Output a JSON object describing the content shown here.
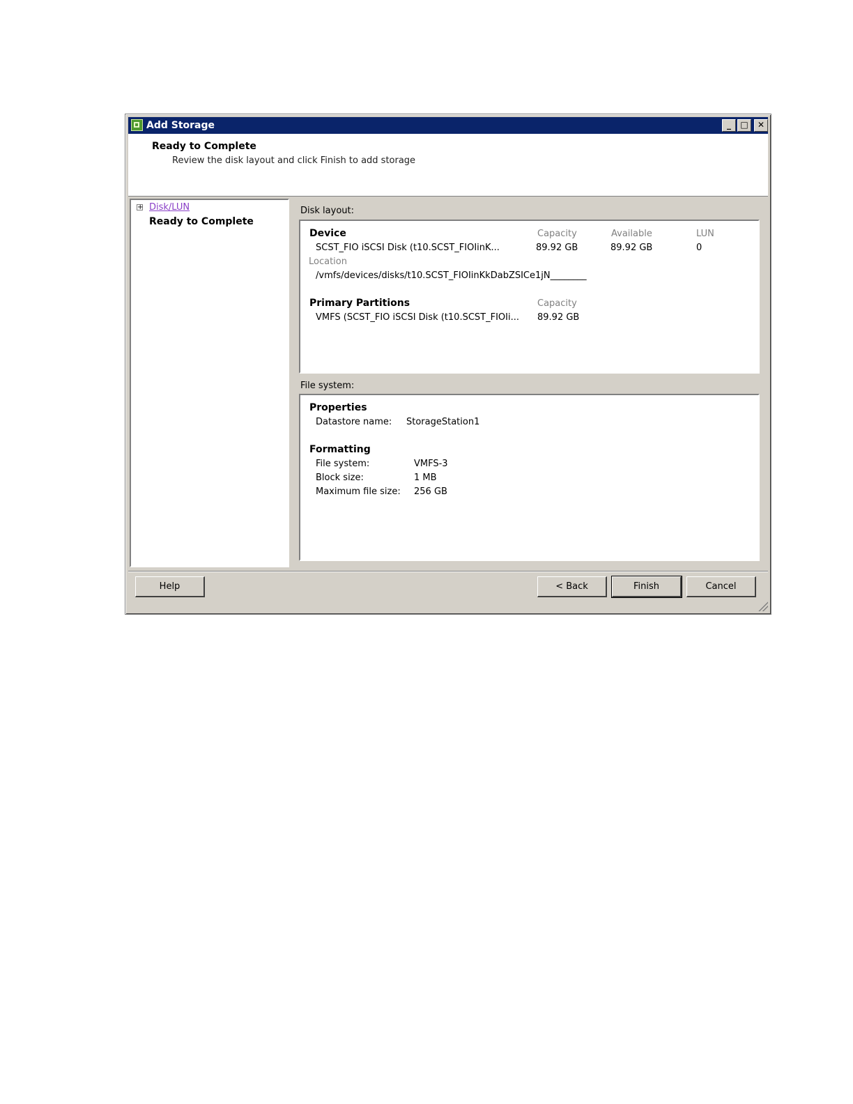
{
  "window": {
    "title": "Add Storage",
    "controls": {
      "minimize": "_",
      "maximize": "□",
      "close": "✕"
    }
  },
  "header": {
    "title": "Ready to Complete",
    "subtitle": "Review the disk layout and click Finish to add storage"
  },
  "nav": {
    "expand_symbol": "+",
    "link": "Disk/LUN",
    "current": "Ready to Complete"
  },
  "disk_layout": {
    "label": "Disk layout:",
    "device_header": "Device",
    "col_capacity": "Capacity",
    "col_available": "Available",
    "col_lun": "LUN",
    "device_name": "SCST_FIO iSCSI Disk (t10.SCST_FIOIinK...",
    "device_capacity": "89.92 GB",
    "device_available": "89.92 GB",
    "device_lun": "0",
    "location_label": "Location",
    "location_path": "/vmfs/devices/disks/t10.SCST_FIOIinKkDabZSICe1jN________",
    "partitions_header": "Primary Partitions",
    "partitions_col_capacity": "Capacity",
    "partition_name": "VMFS (SCST_FIO iSCSI Disk (t10.SCST_FIOIi...",
    "partition_capacity": "89.92 GB"
  },
  "file_system": {
    "label": "File system:",
    "properties_header": "Properties",
    "datastore_label": "Datastore name:",
    "datastore_value": "StorageStation1",
    "formatting_header": "Formatting",
    "fs_label": "File system:",
    "fs_value": "VMFS-3",
    "block_label": "Block size:",
    "block_value": "1 MB",
    "max_label": "Maximum file size:",
    "max_value": "256 GB"
  },
  "buttons": {
    "help": "Help",
    "back": "< Back",
    "finish": "Finish",
    "cancel": "Cancel"
  }
}
